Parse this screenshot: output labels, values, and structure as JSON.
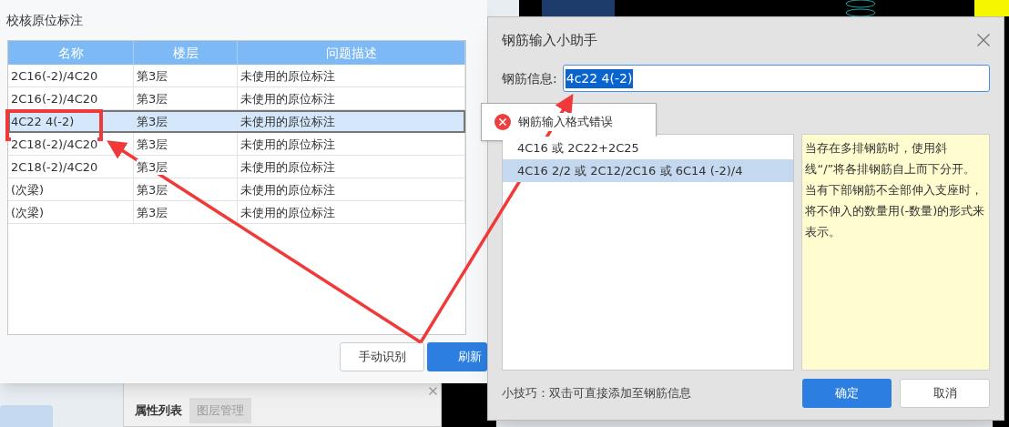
{
  "check_dialog": {
    "title": "校核原位标注",
    "table": {
      "columns": [
        "名称",
        "楼层",
        "问题描述"
      ],
      "rows": [
        {
          "cells": [
            "2C16(-2)/4C20",
            "第3层",
            "未使用的原位标注"
          ],
          "selected": false
        },
        {
          "cells": [
            "2C16(-2)/4C20",
            "第3层",
            "未使用的原位标注"
          ],
          "selected": false
        },
        {
          "cells": [
            "4C22 4(-2)",
            "第3层",
            "未使用的原位标注"
          ],
          "selected": true
        },
        {
          "cells": [
            "2C18(-2)/4C20",
            "第3层",
            "未使用的原位标注"
          ],
          "selected": false
        },
        {
          "cells": [
            "2C18(-2)/4C20",
            "第3层",
            "未使用的原位标注"
          ],
          "selected": false
        },
        {
          "cells": [
            "(次梁)",
            "第3层",
            "未使用的原位标注"
          ],
          "selected": false
        },
        {
          "cells": [
            "(次梁)",
            "第3层",
            "未使用的原位标注"
          ],
          "selected": false
        }
      ]
    },
    "buttons": [
      {
        "label": "手动识别",
        "primary": false
      },
      {
        "label": "刷新",
        "primary": true
      }
    ]
  },
  "panel": {
    "tabs": [
      {
        "label": "属性列表",
        "selected": true
      },
      {
        "label": "图层管理",
        "selected": false
      }
    ]
  },
  "helper_dialog": {
    "title": "钢筋输入小助手",
    "field_label": "钢筋信息:",
    "value": "4c22 4(-2)",
    "error": "钢筋输入格式错误",
    "examples": [
      {
        "text": "4C16 或 2C22+2C25",
        "selected": false
      },
      {
        "text": "4C16 2/2 或 2C12/2C16 或 6C14 (-2)/4",
        "selected": true
      }
    ],
    "hint": "当存在多排钢筋时，使用斜线“/”将各排钢筋自上而下分开。当有下部钢筋不全部伸入支座时，将不伸入的数量用(-数量)的形式来表示。",
    "tip": "小技巧：双击可直接添加至钢筋信息",
    "buttons": [
      {
        "label": "确定",
        "primary": true
      },
      {
        "label": "取消",
        "primary": false
      }
    ]
  }
}
